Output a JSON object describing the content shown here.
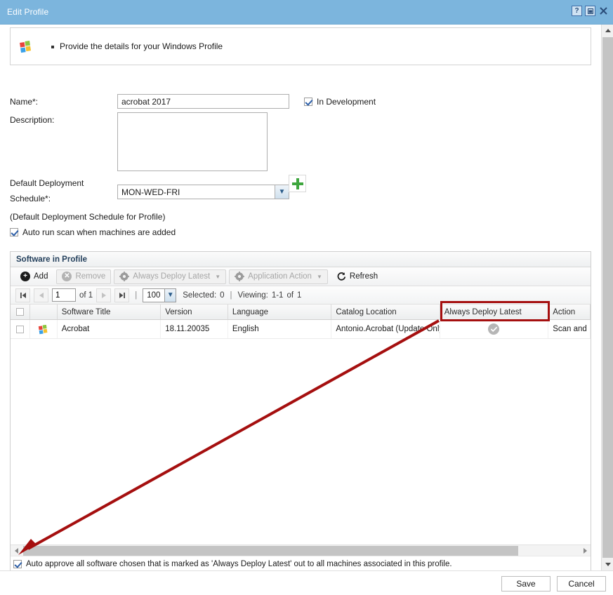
{
  "window": {
    "title": "Edit Profile",
    "controls": [
      {
        "name": "help-button",
        "glyph": "?"
      },
      {
        "name": "maximize-button",
        "glyph": "□"
      },
      {
        "name": "close-button",
        "glyph": "✕"
      }
    ]
  },
  "banner": {
    "icon": "windows-flag-icon",
    "text": "Provide the details for your Windows Profile"
  },
  "form": {
    "name_label": "Name*:",
    "name_value": "acrobat 2017",
    "in_development_label": "In Development",
    "in_development_checked": true,
    "description_label": "Description:",
    "description_value": "",
    "schedule_label_line1": "Default Deployment",
    "schedule_label_line2": "Schedule*:",
    "schedule_value": "MON-WED-FRI",
    "schedule_hint": "(Default Deployment Schedule for Profile)",
    "add_schedule_icon": "plus-icon",
    "auto_run_scan_label": "Auto run scan when machines are added",
    "auto_run_scan_checked": true
  },
  "panel": {
    "title": "Software in Profile",
    "toolbar": [
      {
        "name": "add-button",
        "label": "Add",
        "icon": "plus-circle-icon",
        "enabled": true
      },
      {
        "name": "remove-button",
        "label": "Remove",
        "icon": "x-circle-icon",
        "enabled": false
      },
      {
        "name": "always-deploy-latest-menu",
        "label": "Always Deploy Latest",
        "icon": "gear-icon",
        "enabled": false,
        "dropdown": true
      },
      {
        "name": "application-action-menu",
        "label": "Application Action",
        "icon": "gear-icon",
        "enabled": false,
        "dropdown": true
      },
      {
        "name": "refresh-button",
        "label": "Refresh",
        "icon": "refresh-icon",
        "enabled": true
      }
    ],
    "pager": {
      "first_icon": "first-page-icon",
      "prev_icon": "prev-page-icon",
      "page_value": "1",
      "of_label": "of 1",
      "next_icon": "next-page-icon",
      "last_icon": "last-page-icon",
      "page_size": "100",
      "selected_label": "Selected:",
      "selected_count": "0",
      "viewing_label": "Viewing:",
      "viewing_range": "1-1",
      "viewing_of": "of",
      "viewing_total": "1"
    },
    "grid": {
      "columns": [
        {
          "name": "select-all-column",
          "label": ""
        },
        {
          "name": "icon-column",
          "label": ""
        },
        {
          "name": "software-title-column",
          "label": "Software Title"
        },
        {
          "name": "version-column",
          "label": "Version"
        },
        {
          "name": "language-column",
          "label": "Language"
        },
        {
          "name": "catalog-location-column",
          "label": "Catalog Location"
        },
        {
          "name": "always-deploy-latest-column",
          "label": "Always Deploy Latest"
        },
        {
          "name": "action-column",
          "label": "Action"
        }
      ],
      "rows": [
        {
          "selected": false,
          "icon": "windows-app-icon",
          "software_title": "Acrobat",
          "version": "18.11.20035",
          "language": "English",
          "catalog_location": "Antonio.Acrobat (Update Only)",
          "always_deploy_latest": "check-circle-icon",
          "action": "Scan and"
        }
      ]
    },
    "footer_checkbox": {
      "label": "Auto approve all software chosen that is marked as 'Always Deploy Latest' out to all machines associated in this profile.",
      "checked": true
    }
  },
  "footer": {
    "save_label": "Save",
    "cancel_label": "Cancel"
  },
  "annotation": {
    "highlight_color": "#a50f0f",
    "target": "always-deploy-latest-cell"
  }
}
